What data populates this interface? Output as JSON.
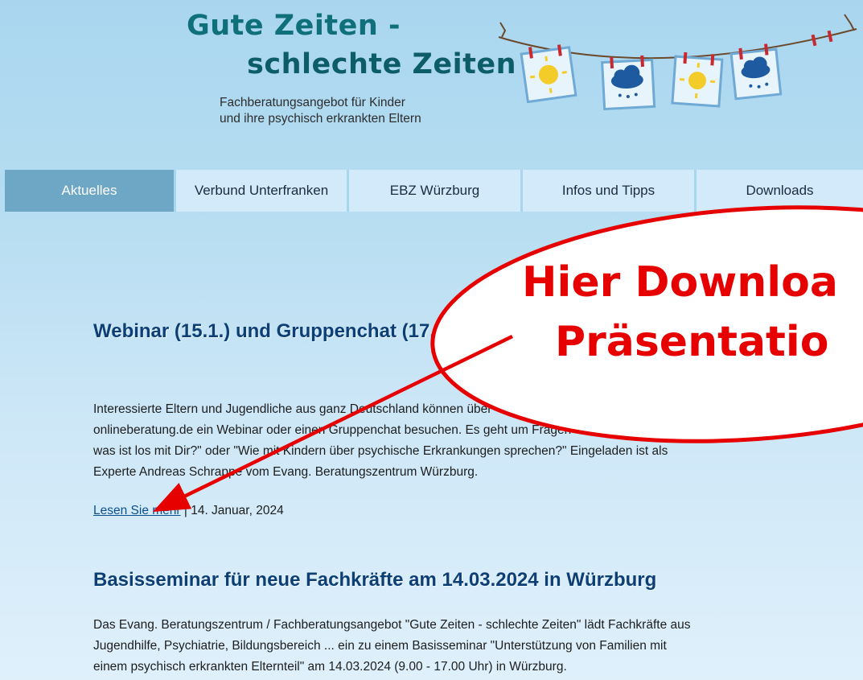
{
  "header": {
    "logo_line1": "Gute Zeiten -",
    "logo_line2": "schlechte Zeiten",
    "tagline_line1": "Fachberatungsangebot für Kinder",
    "tagline_line2": "und ihre psychisch erkrankten Eltern"
  },
  "nav": {
    "items": [
      {
        "label": "Aktuelles",
        "active": true
      },
      {
        "label": "Verbund Unterfranken"
      },
      {
        "label": "EBZ Würzburg"
      },
      {
        "label": "Infos und Tipps"
      },
      {
        "label": "Downloads"
      }
    ]
  },
  "articles": [
    {
      "title": "Webinar (15.1.) und Gruppenchat (17.1.2024)",
      "body": "Interessierte Eltern und Jugendliche aus ganz Deutschland können über onlineberatung.de ein Webinar oder einen Gruppenchat besuchen. Es geht um Fragen was ist los mit Dir?\" oder \"Wie mit Kindern über psychische Erkrankungen sprechen?\" Eingeladen ist als Experte Andreas Schrappe vom Evang. Beratungszentrum Würzburg.",
      "body_lines": [
        "Interessierte Eltern und Jugendliche aus ganz Deutschland können über",
        "onlineberatung.de ein Webinar oder einen Gruppenchat besuchen. Es geht um Fragen",
        "was ist los mit Dir?\" oder \"Wie mit Kindern über psychische Erkrankungen sprechen?\" Eingeladen ist als",
        "Experte Andreas Schrappe vom Evang. Beratungszentrum Würzburg."
      ],
      "read_more": "Lesen Sie mehr",
      "separator": " | ",
      "date": "14. Januar, 2024"
    },
    {
      "title": "Basisseminar für neue Fachkräfte am 14.03.2024 in Würzburg",
      "body_lines": [
        "Das Evang. Beratungszentrum / Fachberatungsangebot \"Gute Zeiten - schlechte Zeiten\" lädt Fachkräfte aus",
        "Jugendhilfe, Psychiatrie, Bildungsbereich ... ein zu einem Basisseminar \"Unterstützung von Familien mit",
        "einem psychisch erkrankten Elternteil\" am 14.03.2024 (9.00 - 17.00 Uhr) in Würzburg."
      ]
    }
  ],
  "annotation": {
    "line1": "Hier Downloa",
    "line2": "Präsentatio",
    "color": "#e60000"
  },
  "colors": {
    "title": "#0d3f75",
    "nav_active": "#6ea6c6",
    "nav_bg": "#d3eafa",
    "logo": "#0f6f7a"
  }
}
